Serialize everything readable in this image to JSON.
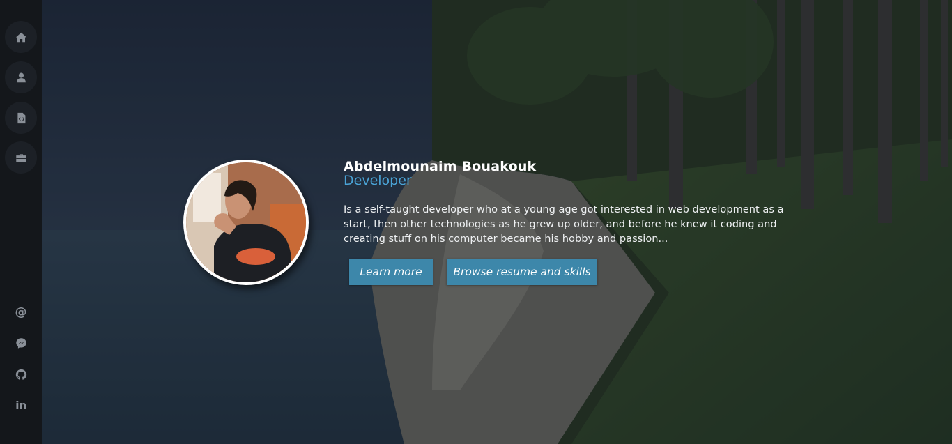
{
  "profile": {
    "name": "Abdelmounaim Bouakouk",
    "role": "Developer",
    "bio": "Is a self-taught developer who at a young age got interested in web development as a start, then other technologies as he grew up older, and before he knew it coding and creating stuff on his computer became his hobby and passion..."
  },
  "actions": {
    "learn_more": "Learn more",
    "browse_resume": "Browse resume and skills"
  },
  "sidebar": {
    "nav": [
      "home-icon",
      "user-icon",
      "code-file-icon",
      "briefcase-icon"
    ],
    "social": [
      "at-icon",
      "messenger-icon",
      "github-icon",
      "linkedin-icon"
    ],
    "at_glyph": "@",
    "in_glyph": "in"
  },
  "colors": {
    "accent": "#4aa3d6",
    "button": "#3d87aa",
    "sidebar": "#14171b"
  }
}
